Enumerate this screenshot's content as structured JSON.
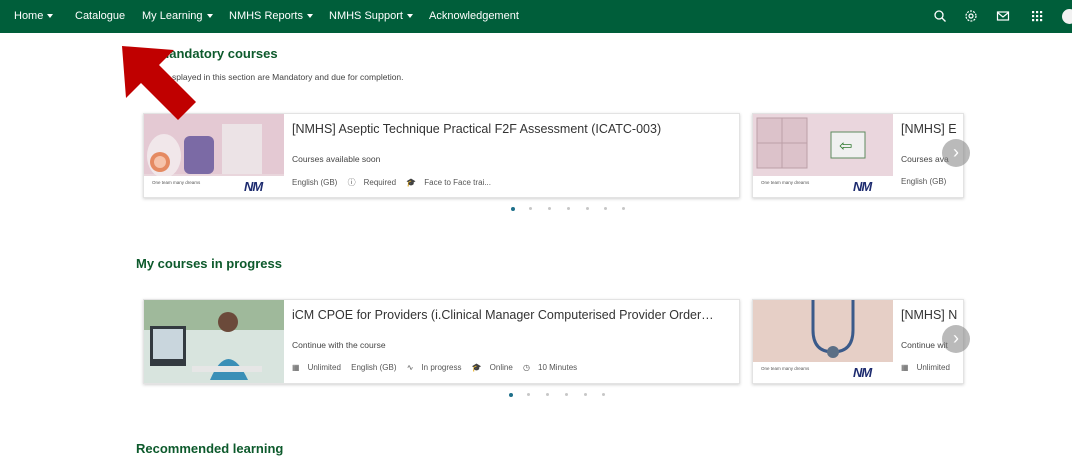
{
  "nav": {
    "items": [
      {
        "label": "Home",
        "caret": true
      },
      {
        "label": "Catalogue",
        "caret": false
      },
      {
        "label": "My Learning",
        "caret": true
      },
      {
        "label": "NMHS Reports",
        "caret": true
      },
      {
        "label": "NMHS Support",
        "caret": true
      },
      {
        "label": "Acknowledgement",
        "caret": false
      }
    ],
    "icons": [
      "search-icon",
      "settings-icon",
      "mail-icon",
      "apps-grid-icon",
      "avatar"
    ]
  },
  "mandatory": {
    "title": "My mandatory courses",
    "subtitle": "splayed in this section are Mandatory and due for completion.",
    "card1": {
      "title": "[NMHS] Aseptic Technique Practical F2F Assessment (ICATC-003)",
      "status": "Courses available soon",
      "language": "English (GB)",
      "required": "Required",
      "format": "Face to Face trai..."
    },
    "card2": {
      "title": "[NMHS] E",
      "status": "Courses ava",
      "language": "English (GB)"
    }
  },
  "progress": {
    "title": "My courses in progress",
    "card1": {
      "title": "iCM CPOE for Providers (i.Clinical Manager Computerised Provider Order…",
      "status": "Continue with the course",
      "duration_type": "Unlimited",
      "language": "English (GB)",
      "progress": "In progress",
      "format": "Online",
      "time": "10 Minutes"
    },
    "card2": {
      "title": "[NMHS] N",
      "status": "Continue wit",
      "duration_type": "Unlimited"
    }
  },
  "recommended": {
    "title": "Recommended learning"
  },
  "brand": {
    "logo": "NM",
    "caption": "One team many dreams"
  },
  "colors": {
    "nav_bg": "#005e3a",
    "heading": "#0d5a2c",
    "arrow": "#c00000",
    "active_dot": "#1e6f8a"
  }
}
